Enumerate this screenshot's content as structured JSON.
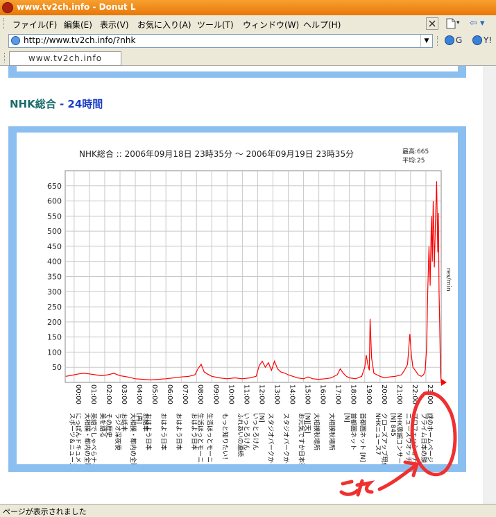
{
  "window": {
    "title": "www.tv2ch.info - Donut L"
  },
  "menu": {
    "items": [
      "ファイル(F)",
      "編集(E)",
      "表示(V)",
      "お気に入り(A)",
      "ツール(T)",
      "ウィンドウ(W)",
      "ヘルプ(H)"
    ]
  },
  "toolbar": {
    "new_arrow": "▾",
    "back_arrow": "⇦ ▾",
    "search_g": "G",
    "search_y": "Y!"
  },
  "address": {
    "url": "http://www.tv2ch.info/?nhk"
  },
  "tabs": [
    {
      "label": "www.tv2ch.info"
    }
  ],
  "page": {
    "heading_name": "NHK総合",
    "heading_dash": " - ",
    "heading_period": "24時間"
  },
  "chart_data": {
    "type": "line",
    "title": "NHK総合 :: 2006年09月18日 23時35分 〜 2006年09月19日 23時35分",
    "stats": {
      "max_label": "最高:665",
      "avg_label": "平均:25"
    },
    "ylabel": "res/min",
    "ylim": [
      0,
      700
    ],
    "yticks": [
      50,
      100,
      150,
      200,
      250,
      300,
      350,
      400,
      450,
      500,
      550,
      600,
      650
    ],
    "xlim": [
      -0.5833,
      24
    ],
    "x_ticks": [
      "00:00",
      "01:00",
      "02:00",
      "03:00",
      "04:00",
      "05:00",
      "06:00",
      "07:00",
      "08:00",
      "09:00",
      "10:00",
      "11:00",
      "12:00",
      "13:00",
      "14:00",
      "15:00",
      "16:00",
      "17:00",
      "18:00",
      "19:00",
      "20:00",
      "21:00",
      "22:00",
      "23:00"
    ],
    "programs": [
      {
        "t": 0.0,
        "lines": [
          "スポーツ＆ニュース",
          "にっぽんドキュメント"
        ]
      },
      {
        "t": 1.0,
        "lines": [
          "大相撲・都内の全取組",
          "英語でしゃべらナイト"
        ]
      },
      {
        "t": 2.0,
        "lines": [
          "美を語る",
          "その歴史"
        ]
      },
      {
        "t": 3.0,
        "lines": [
          "ラジオ深夜便",
          "お話本"
        ]
      },
      {
        "t": 4.0,
        "lines": [
          "大相撲・都内の全取組",
          "[再]",
          "お話本"
        ]
      },
      {
        "t": 5.0,
        "lines": [
          "おはよう日本"
        ]
      },
      {
        "t": 6.0,
        "lines": [
          "おはよう日本"
        ]
      },
      {
        "t": 7.0,
        "lines": [
          "おはよう日本"
        ]
      },
      {
        "t": 8.0,
        "lines": [
          "おはよう日本",
          "生活ほっとモーニング"
        ]
      },
      {
        "t": 9.0,
        "lines": [
          "生活ほっとモーニング"
        ]
      },
      {
        "t": 10.0,
        "lines": [
          "もっと知りたい！"
        ]
      },
      {
        "t": 11.0,
        "lines": [
          "ふれあいの連続",
          "いっとろけん"
        ]
      },
      {
        "t": 12.0,
        "lines": [
          "いっとろけん",
          "[N]"
        ]
      },
      {
        "t": 13.0,
        "lines": [
          "スタジオパークからこんにちは"
        ]
      },
      {
        "t": 14.0,
        "lines": [
          "スタジオパークからこんにちは"
        ]
      },
      {
        "t": 15.0,
        "lines": [
          "お元気ですか日本列島",
          "[N][天]"
        ]
      },
      {
        "t": 16.0,
        "lines": [
          "大相撲秋場所"
        ]
      },
      {
        "t": 17.0,
        "lines": [
          "大相撲秋場所"
        ]
      },
      {
        "t": 18.0,
        "lines": [
          "[N]",
          "首都圏ネット"
        ]
      },
      {
        "t": 19.0,
        "lines": [
          "首都圏ネット [N]"
        ]
      },
      {
        "t": 20.0,
        "lines": [
          "NHKニュース7",
          "クローズアップ現代"
        ]
      },
      {
        "t": 21.0,
        "lines": [
          "[N] 845",
          "NHK歌謡コンサート"
        ]
      },
      {
        "t": 22.0,
        "lines": [
          "ニュースウオッチ9",
          "プロフェッショナル"
        ]
      },
      {
        "t": 23.0,
        "lines": [
          "プライム日本の顔",
          "謎のホームページ サラリーマン"
        ]
      }
    ],
    "series": [
      {
        "color": "#ff0000",
        "x": [
          -0.55,
          -0.3,
          0,
          0.3,
          0.6,
          1,
          1.4,
          1.8,
          2.2,
          2.6,
          3,
          3.5,
          4,
          4.5,
          5,
          5.5,
          6,
          6.5,
          7,
          7.5,
          7.9,
          8.1,
          8.3,
          8.5,
          8.7,
          9,
          9.5,
          10,
          10.5,
          11,
          11.5,
          11.9,
          12.1,
          12.3,
          12.5,
          12.7,
          12.9,
          13.1,
          13.3,
          13.5,
          13.8,
          14,
          14.3,
          14.6,
          15,
          15.3,
          15.6,
          16,
          16.4,
          16.8,
          17.2,
          17.4,
          17.6,
          17.8,
          18,
          18.4,
          18.8,
          19,
          19.1,
          19.2,
          19.3,
          19.35,
          19.45,
          19.6,
          19.8,
          20,
          20.3,
          20.6,
          21,
          21.4,
          21.6,
          21.8,
          21.95,
          22.05,
          22.15,
          22.3,
          22.5,
          22.7,
          22.85,
          22.95,
          23.05,
          23.12,
          23.2,
          23.28,
          23.36,
          23.42,
          23.48,
          23.55,
          23.62,
          23.7,
          23.78,
          23.82,
          23.86,
          23.9,
          23.93,
          23.96,
          24
        ],
        "y": [
          20,
          22,
          25,
          28,
          30,
          28,
          25,
          22,
          25,
          30,
          22,
          18,
          12,
          10,
          8,
          10,
          12,
          15,
          18,
          20,
          25,
          45,
          60,
          35,
          28,
          20,
          15,
          12,
          15,
          12,
          15,
          20,
          55,
          70,
          50,
          65,
          40,
          70,
          45,
          35,
          30,
          25,
          20,
          15,
          12,
          18,
          12,
          10,
          12,
          15,
          25,
          45,
          30,
          20,
          15,
          12,
          20,
          50,
          90,
          60,
          40,
          210,
          80,
          30,
          25,
          20,
          15,
          18,
          20,
          25,
          40,
          60,
          160,
          90,
          50,
          40,
          25,
          20,
          25,
          40,
          120,
          300,
          450,
          320,
          550,
          400,
          600,
          380,
          520,
          665,
          430,
          560,
          300,
          200,
          100,
          30,
          0
        ]
      }
    ]
  }
}
